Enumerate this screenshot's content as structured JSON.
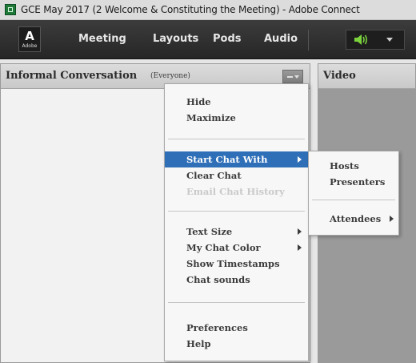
{
  "window": {
    "title": "GCE May 2017 (2 Welcome & Constituting the Meeting) - Adobe Connect",
    "icon": "adobe-connect-icon"
  },
  "menubar": {
    "logo_mark": "A",
    "logo_text": "Adobe",
    "items": [
      "Meeting",
      "Layouts",
      "Pods",
      "Audio"
    ],
    "audio_icon": "speaker-icon",
    "audio_icon_color": "#7bd23c"
  },
  "chat_pod": {
    "title": "Informal Conversation",
    "subtitle": "(Everyone)",
    "menu_icon": "pod-options-icon"
  },
  "video_pod": {
    "title": "Video"
  },
  "dropdown": {
    "items": [
      {
        "label": "Hide",
        "state": "normal"
      },
      {
        "label": "Maximize",
        "state": "normal"
      },
      {
        "label": "Start Chat With",
        "state": "highlighted",
        "submenu": true
      },
      {
        "label": "Clear Chat",
        "state": "normal"
      },
      {
        "label": "Email Chat History",
        "state": "disabled"
      },
      {
        "label": "Text Size",
        "state": "normal",
        "submenu": true
      },
      {
        "label": "My Chat Color",
        "state": "normal",
        "submenu": true
      },
      {
        "label": "Show Timestamps",
        "state": "normal"
      },
      {
        "label": "Chat sounds",
        "state": "normal"
      },
      {
        "label": "Preferences",
        "state": "normal"
      },
      {
        "label": "Help",
        "state": "normal"
      }
    ]
  },
  "submenu": {
    "items": [
      {
        "label": "Hosts"
      },
      {
        "label": "Presenters"
      },
      {
        "label": "Attendees",
        "submenu": true
      }
    ]
  },
  "colors": {
    "highlight": "#2f6fb8",
    "menubar": "#2e2e2e",
    "pod_header": "#d2d2d2"
  }
}
